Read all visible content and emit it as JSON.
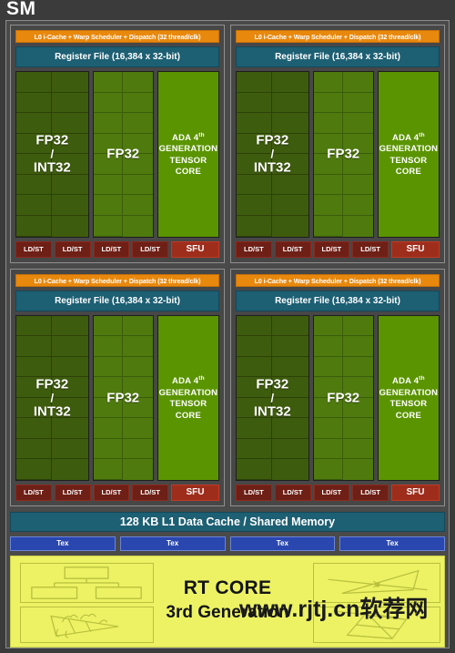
{
  "diagram": {
    "title": "SM",
    "colors": {
      "background": "#3b3b3b",
      "scheduler_orange": "#e8880d",
      "register_teal": "#1d5f73",
      "fp32_int32_green": "#3e5c0d",
      "fp32_green": "#4f7a0e",
      "tensor_core_green": "#5a9400",
      "ldst_red": "#6e1f16",
      "sfu_red": "#9e2d1c",
      "tex_blue": "#2a47b0",
      "rt_core_yellow": "#ecf264"
    }
  },
  "partition": {
    "scheduler_label": "L0 i-Cache + Warp Scheduler + Dispatch (32 thread/clk)",
    "register_file_label": "Register File (16,384 x 32-bit)",
    "fp32_int32_label_line1": "FP32",
    "fp32_int32_label_line2": "/",
    "fp32_int32_label_line3": "INT32",
    "fp32_label": "FP32",
    "tensor_core_line1": "ADA 4",
    "tensor_core_sup": "th",
    "tensor_core_line2": "GENERATION",
    "tensor_core_line3": "TENSOR CORE",
    "ldst_label": "LD/ST",
    "sfu_label": "SFU",
    "core_rows": 8,
    "core_cols_per_block": 2,
    "ldst_count": 4
  },
  "partitions": [
    {
      "id": "partition-top-left"
    },
    {
      "id": "partition-top-right"
    },
    {
      "id": "partition-bottom-left"
    },
    {
      "id": "partition-bottom-right"
    }
  ],
  "l1_cache": {
    "label": "128 KB L1 Data Cache / Shared Memory"
  },
  "tex": {
    "label": "Tex",
    "count": 4
  },
  "rt_core": {
    "title": "RT CORE",
    "subtitle": "3rd Generation",
    "icons": [
      {
        "name": "bvh-tree-icon",
        "position": "top-left"
      },
      {
        "name": "triangle-mesh-icon",
        "position": "bottom-left"
      },
      {
        "name": "ray-triangle-intersection-icon",
        "position": "top-right"
      },
      {
        "name": "box-intersection-icon",
        "position": "bottom-right"
      }
    ]
  },
  "watermark": {
    "text": "www.rjtj.cn软荐网"
  }
}
